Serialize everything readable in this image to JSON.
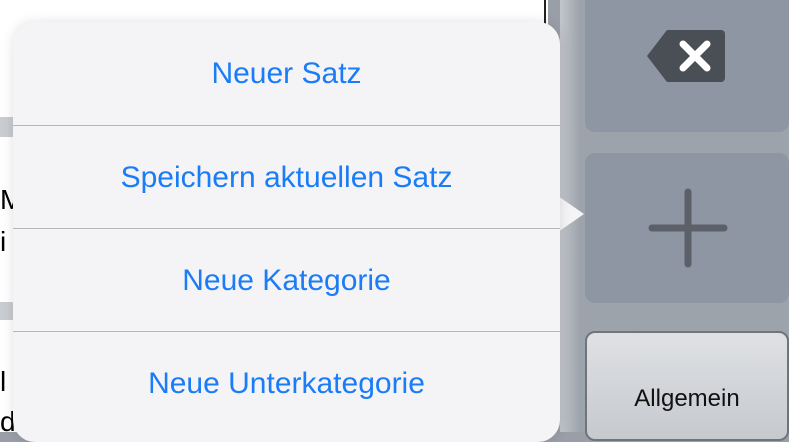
{
  "popover_menu": {
    "items": [
      {
        "label": "Neuer Satz"
      },
      {
        "label": "Speichern aktuellen Satz"
      },
      {
        "label": "Neue Kategorie"
      },
      {
        "label": "Neue Unterkategorie"
      }
    ],
    "accent_color": "#1a7cf6"
  },
  "keyboard": {
    "delete_icon": "delete-backspace-icon",
    "add_icon": "plus-icon",
    "category_label": "Allgemein"
  },
  "background_text": {
    "chars": [
      "M",
      "i",
      "l",
      "d"
    ]
  }
}
